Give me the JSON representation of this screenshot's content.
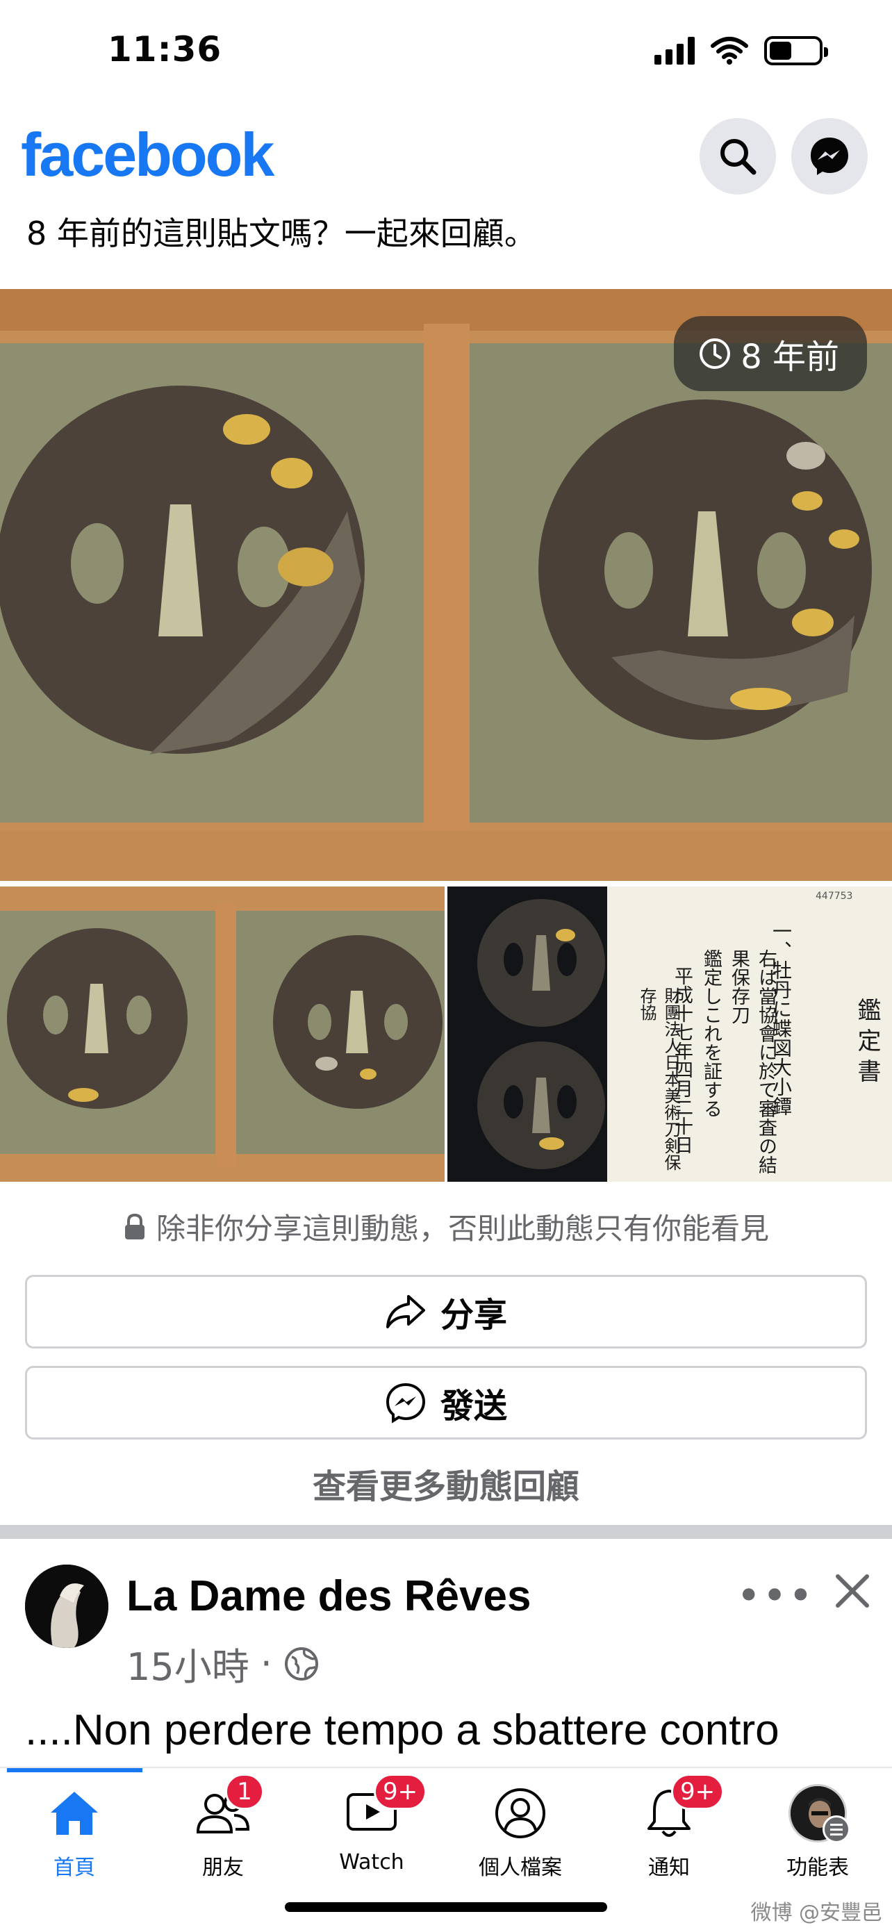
{
  "status_bar": {
    "time": "11:36"
  },
  "header": {
    "logo": "facebook",
    "search_icon": "search-icon",
    "messenger_icon": "messenger-icon"
  },
  "memory": {
    "prompt": "8 年前的這則貼文嗎？一起來回顧。",
    "badge": "8 年前",
    "privacy_note": "除非你分享這則動態，否則此動態只有你能看見",
    "share_label": "分享",
    "send_label": "發送",
    "more_label": "查看更多動態回顧",
    "document_title": "鑑定書",
    "document_lines": [
      "一、牡丹に蝶図大小鐔",
      "右は當協會に於て審査の結果保存刀",
      "鑑定しこれを証する",
      "平成十七年四月二十日",
      "財團法人日本美術刀剣保存協"
    ],
    "document_number": "447753",
    "colors": {
      "wood": "#c9935c",
      "felt": "#8f8f72",
      "tsuba": "#4b4037",
      "gold": "#d9b24a"
    }
  },
  "post": {
    "author": "La Dame des Rêves",
    "time": "15小時",
    "separator": "·",
    "text": "....Non perdere tempo a sbattere contro",
    "more": "•••"
  },
  "tabs": [
    {
      "label": "首頁",
      "icon": "home-icon",
      "badge": ""
    },
    {
      "label": "朋友",
      "icon": "friends-icon",
      "badge": "1"
    },
    {
      "label": "Watch",
      "icon": "watch-icon",
      "badge": "9+"
    },
    {
      "label": "個人檔案",
      "icon": "profile-icon",
      "badge": ""
    },
    {
      "label": "通知",
      "icon": "bell-icon",
      "badge": "9+"
    },
    {
      "label": "功能表",
      "icon": "menu-avatar",
      "badge": ""
    }
  ],
  "watermark": "微博 @安豐邑",
  "accent": "#1877f2",
  "badge_color": "#e41e3f"
}
